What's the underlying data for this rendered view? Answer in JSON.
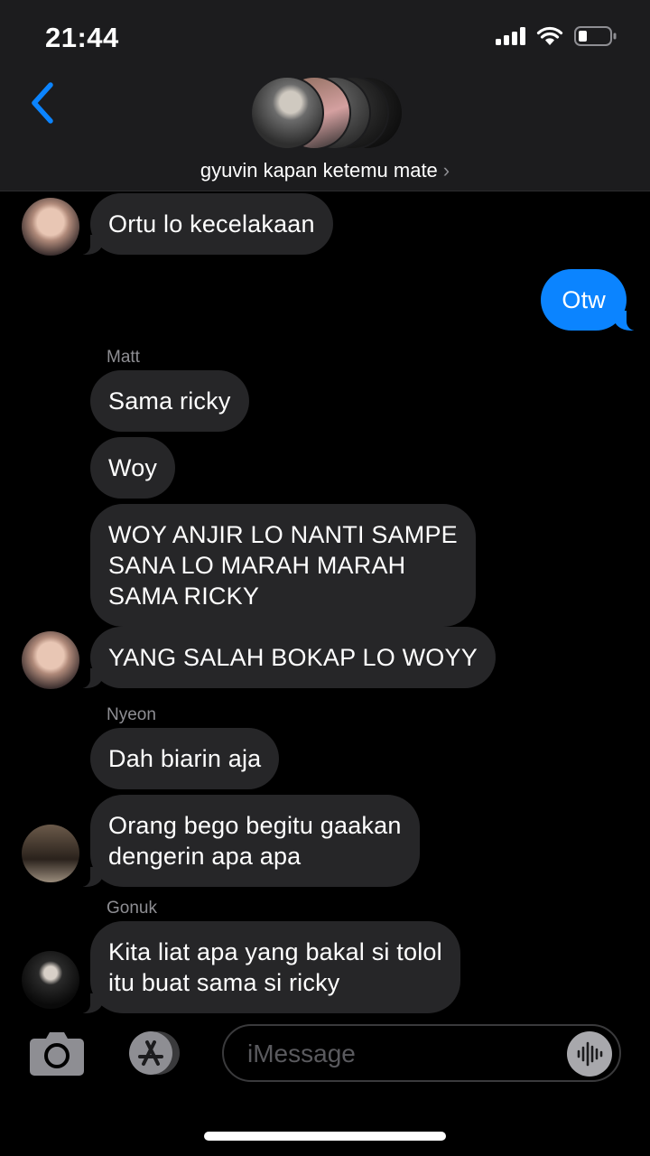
{
  "status_bar": {
    "time": "21:44"
  },
  "header": {
    "group_name": "gyuvin kapan ketemu mate",
    "chevron": "›"
  },
  "composer": {
    "placeholder": "iMessage"
  },
  "messages": [
    {
      "text": "Ortu lo kecelakaan"
    },
    {
      "text": "Otw"
    },
    {
      "sender": "Matt",
      "text": "Sama ricky"
    },
    {
      "text": "Woy"
    },
    {
      "text": "WOY ANJIR LO NANTI SAMPE\nSANA LO MARAH MARAH\nSAMA RICKY"
    },
    {
      "text": "YANG SALAH BOKAP LO WOYY"
    },
    {
      "sender": "Nyeon",
      "text": "Dah biarin aja"
    },
    {
      "text": "Orang bego begitu gaakan\ndengerin apa apa"
    },
    {
      "sender": "Gonuk",
      "text": "Kita liat apa yang bakal si tolol\nitu buat sama si ricky"
    }
  ],
  "icons": {
    "back": "chevron-left-icon",
    "video": "video-camera-icon",
    "camera": "camera-icon",
    "appstore": "app-store-icon",
    "audio": "audio-waveform-icon"
  },
  "colors": {
    "accent": "#0b84ff",
    "incoming_bubble": "#262628",
    "header_bg": "#1c1c1e"
  }
}
